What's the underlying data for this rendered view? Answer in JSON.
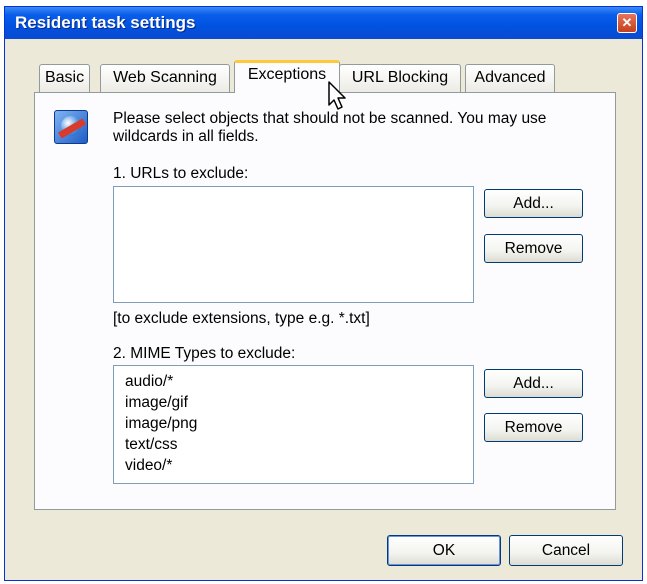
{
  "window": {
    "title": "Resident task settings",
    "close_glyph": "✕"
  },
  "tabs": [
    {
      "label": "Basic"
    },
    {
      "label": "Web Scanning"
    },
    {
      "label": "Exceptions"
    },
    {
      "label": "URL Blocking"
    },
    {
      "label": "Advanced"
    }
  ],
  "active_tab": "Exceptions",
  "panel": {
    "description_line1": "Please select objects that should not be scanned. You may use",
    "description_line2": "wildcards in all fields.",
    "urls": {
      "label": "1. URLs to exclude:",
      "items": [],
      "hint": "[to exclude extensions, type e.g. *.txt]",
      "add_label": "Add...",
      "remove_label": "Remove"
    },
    "mime": {
      "label": "2. MIME Types to exclude:",
      "items": [
        "audio/*",
        "image/gif",
        "image/png",
        "text/css",
        "video/*"
      ],
      "add_label": "Add...",
      "remove_label": "Remove"
    }
  },
  "footer": {
    "ok_label": "OK",
    "cancel_label": "Cancel"
  },
  "icons": {
    "info_icon": "globe-shield-icon",
    "cursor": "mouse-pointer-icon"
  }
}
